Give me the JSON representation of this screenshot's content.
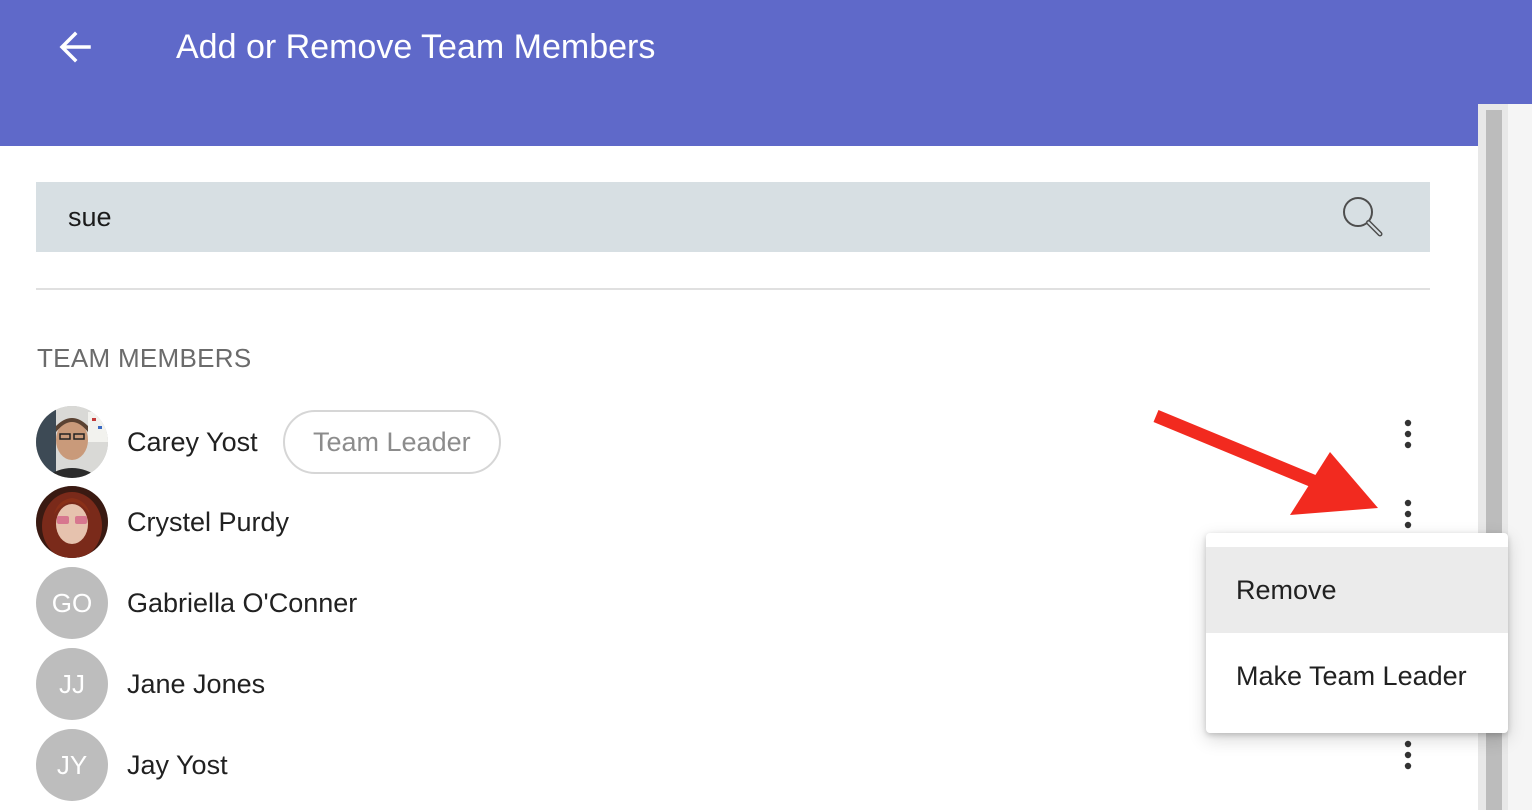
{
  "header": {
    "title": "Add or Remove Team Members",
    "back_icon": "arrow-left-icon",
    "background_color": "#5f69c9"
  },
  "search": {
    "value": "sue",
    "placeholder": "",
    "icon": "search-icon",
    "background_color": "#d7dfe3"
  },
  "section": {
    "title": "TEAM MEMBERS"
  },
  "members": [
    {
      "name": "Carey Yost",
      "avatar": "photo",
      "badge": "Team Leader"
    },
    {
      "name": "Crystel Purdy",
      "avatar": "photo"
    },
    {
      "name": "Gabriella O'Conner",
      "initials": "GO"
    },
    {
      "name": "Jane Jones",
      "initials": "JJ"
    },
    {
      "name": "Jay Yost",
      "initials": "JY"
    }
  ],
  "context_menu": {
    "items": [
      {
        "label": "Remove",
        "highlighted": true
      },
      {
        "label": "Make Team Leader",
        "highlighted": false
      }
    ]
  },
  "annotation": {
    "arrow_color": "#f22a1f"
  }
}
